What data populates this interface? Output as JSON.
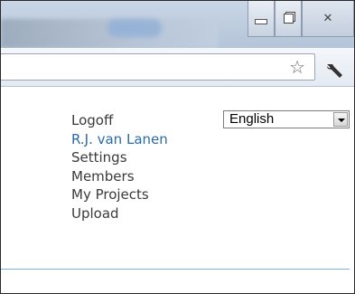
{
  "window": {
    "buttons": {
      "minimize_icon": "minimize-icon",
      "maximize_icon": "maximize-icon",
      "close_icon": "close-icon",
      "close_glyph": "✕"
    }
  },
  "toolbar": {
    "star_glyph": "☆",
    "wrench_icon": "wrench-icon"
  },
  "nav": {
    "items": [
      {
        "label": "Logoff"
      },
      {
        "label": "R.J. van Lanen"
      },
      {
        "label": "Settings"
      },
      {
        "label": "Members"
      },
      {
        "label": "My Projects"
      },
      {
        "label": "Upload"
      }
    ]
  },
  "language": {
    "selected": "English"
  },
  "colors": {
    "user_link": "#2b6aa8",
    "divider": "#7fb2d6"
  }
}
